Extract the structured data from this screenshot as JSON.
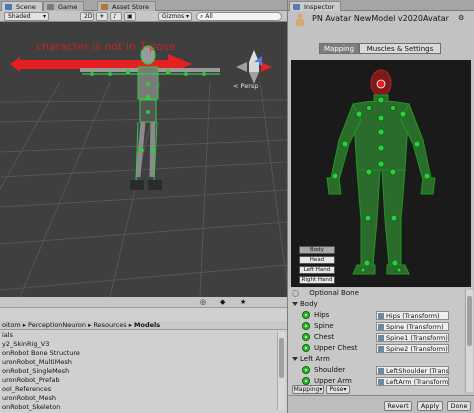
{
  "scene_tabs": [
    {
      "label": "Scene",
      "icon": "scene-icon",
      "color": "#4a7ab0"
    },
    {
      "label": "Game",
      "icon": "game-icon",
      "color": "#7a7a7a"
    },
    {
      "label": "Asset Store",
      "icon": "asset-store-icon",
      "color": "#b07a3a"
    }
  ],
  "scene_toolbar": {
    "shading": "Shaded",
    "mode_2d": "2D",
    "gizmos": "Gizmos",
    "search_placeholder": "All"
  },
  "scene_view": {
    "overlay_text": "character is not in T-pose",
    "persp_label": "< Persp"
  },
  "project": {
    "breadcrumb": [
      "oitom",
      "PerceptionNeuron",
      "Resources",
      "Models"
    ],
    "items": [
      "ials",
      "y2_SkinRig_V3",
      "onRobot Bone Structure",
      "uronRobot_MultiMesh",
      "onRobot_SingleMesh",
      "uronRobot_Prefab",
      "ool_References",
      "uronRobot_Mesh",
      "onRobot_Skeleton"
    ]
  },
  "inspector": {
    "tab_label": "Inspector",
    "title": "PN Avatar NewModel v2020Avatar",
    "mapping_tab": "Mapping",
    "muscles_tab": "Muscles & Settings",
    "body_buttons": [
      "Body",
      "Head",
      "Left Hand",
      "Right Hand"
    ],
    "optional_bone": "Optional Bone",
    "sections": [
      {
        "title": "Body",
        "rows": [
          {
            "label": "Hips",
            "value": "Hips (Transform)"
          },
          {
            "label": "Spine",
            "value": "Spine (Transform)"
          },
          {
            "label": "Chest",
            "value": "Spine1 (Transform)"
          },
          {
            "label": "Upper Chest",
            "value": "Spine2 (Transform)"
          }
        ]
      },
      {
        "title": "Left Arm",
        "rows": [
          {
            "label": "Shoulder",
            "value": "LeftShoulder (Transform)"
          },
          {
            "label": "Upper Arm",
            "value": "LeftArm (Transform)"
          }
        ]
      }
    ],
    "bottom_tabs": [
      "Mapping",
      "Pose"
    ],
    "revert": "Revert",
    "apply": "Apply",
    "done": "Done"
  },
  "colors": {
    "bone_green": "#2ecc40",
    "red_arrow": "#e62020",
    "scene_bg": "#3f3f3f",
    "selected_avatar_bg": "#1a1a1a"
  }
}
